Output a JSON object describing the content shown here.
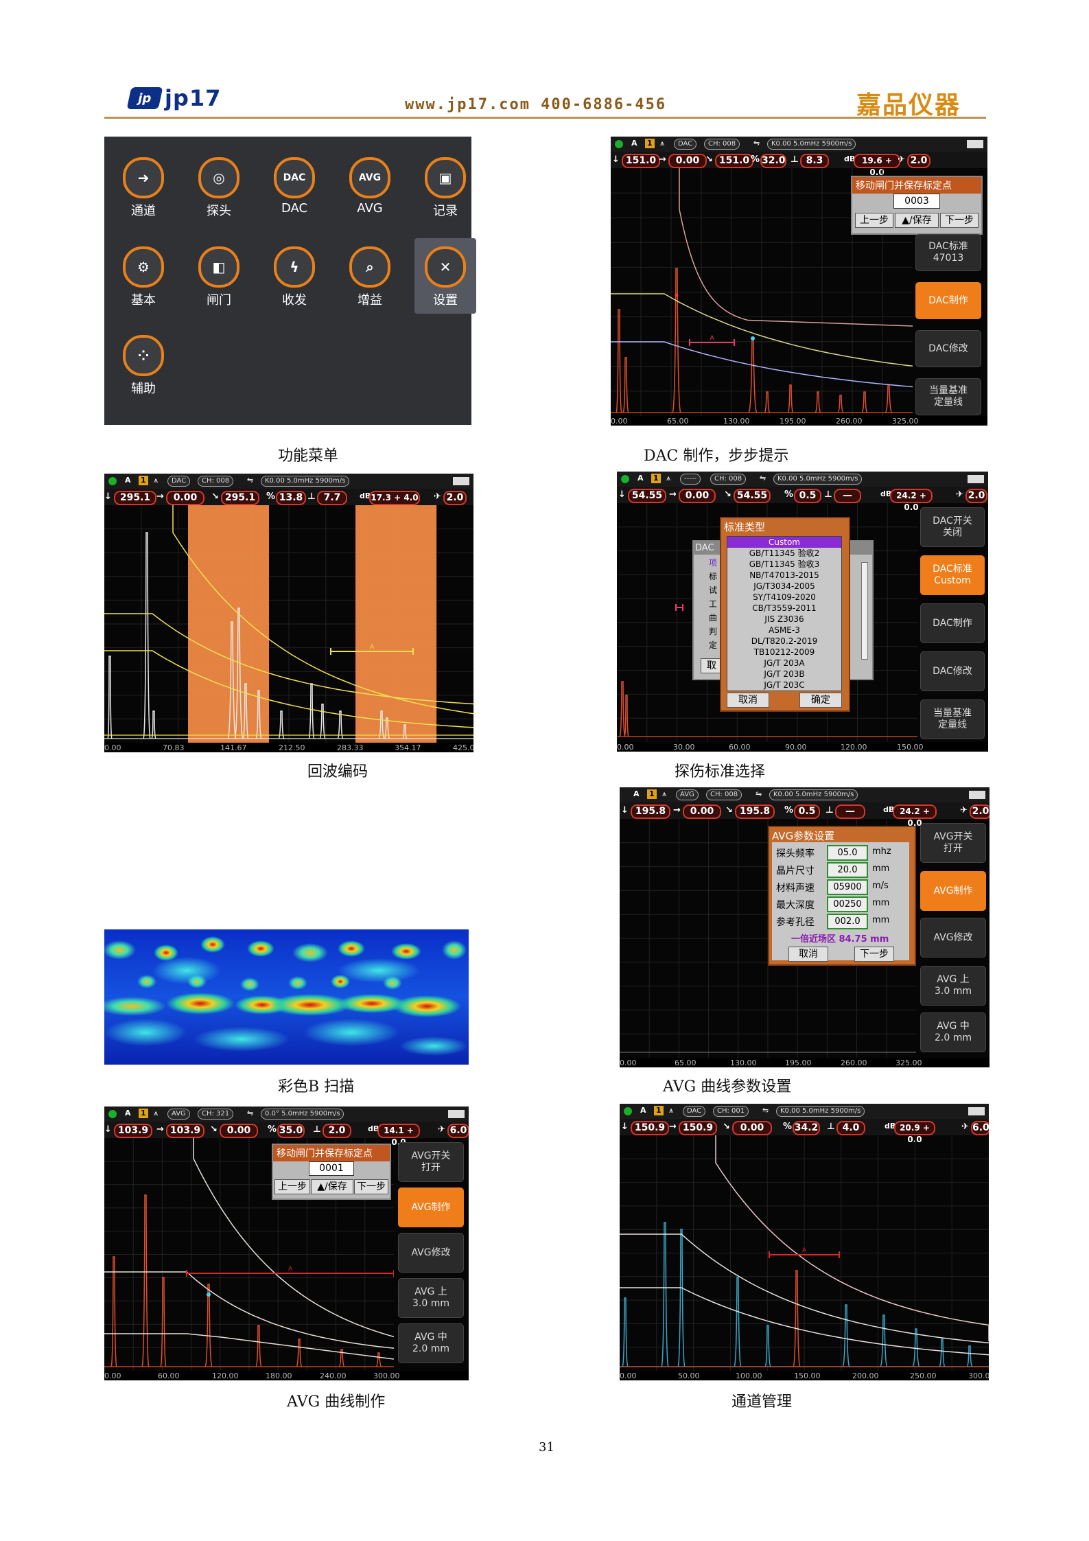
{
  "header": {
    "logo_mark": "jp",
    "logo_text": "jp17",
    "url": "www.jp17.com  400-6886-456",
    "brand": "嘉品仪器"
  },
  "page_number": "31",
  "captions": {
    "menu": "功能菜单",
    "dac_make": "DAC 制作，步步提示",
    "echo": "回波编码",
    "standard": "探伤标准选择",
    "bscan": "彩色B 扫描",
    "avg_param": "AVG 曲线参数设置",
    "avg_make": "AVG 曲线制作",
    "channel": "通道管理"
  },
  "menu": {
    "items": [
      {
        "label": "通道",
        "icon": "arrow-right-icon",
        "glyph": "➜"
      },
      {
        "label": "探头",
        "icon": "probe-icon",
        "glyph": "◎"
      },
      {
        "label": "DAC",
        "icon": "dac-icon",
        "glyph": "DAC"
      },
      {
        "label": "AVG",
        "icon": "avg-icon",
        "glyph": "AVG"
      },
      {
        "label": "记录",
        "icon": "save-icon",
        "glyph": "▣"
      },
      {
        "label": "基本",
        "icon": "gear-icon",
        "glyph": "⚙"
      },
      {
        "label": "闸门",
        "icon": "gate-icon",
        "glyph": "◧"
      },
      {
        "label": "收发",
        "icon": "pulse-icon",
        "glyph": "ϟ"
      },
      {
        "label": "增益",
        "icon": "search-icon",
        "glyph": "⌕"
      },
      {
        "label": "设置",
        "icon": "tools-icon",
        "glyph": "✕"
      },
      {
        "label": "辅助",
        "icon": "dots-icon",
        "glyph": "⁘"
      }
    ]
  },
  "dac": {
    "top": {
      "mode": "A",
      "num": "1",
      "type": "DAC",
      "ch": "CH: 008",
      "probe": "K0.00  5.0mHz  5900m/s"
    },
    "vals": [
      "151.0",
      "0.00",
      "151.0",
      "32.0",
      "8.3",
      "19.6 + 0.0",
      "2.0"
    ],
    "dialog": {
      "title": "移动闸门并保存标定点",
      "value": "0003",
      "prev": "上一步",
      "save": "▲/保存",
      "next": "下一步"
    },
    "buttons": [
      "DAC标准\n47013",
      "DAC制作",
      "DAC修改",
      "当量基准\n定量线"
    ],
    "axis": [
      "0.00",
      "65.00",
      "130.00",
      "195.00",
      "260.00",
      "325.00"
    ],
    "gate_label": "A"
  },
  "echo": {
    "top": {
      "mode": "A",
      "num": "1",
      "type": "DAC",
      "ch": "CH: 008",
      "probe": "K0.00  5.0mHz  5900m/s"
    },
    "vals": [
      "295.1",
      "0.00",
      "295.1",
      "13.8",
      "7.7",
      "17.3 + 4.0",
      "2.0"
    ],
    "axis": [
      "0.00",
      "70.83",
      "141.67",
      "212.50",
      "283.33",
      "354.17",
      "425.00"
    ],
    "gate_label": "A"
  },
  "standard": {
    "top": {
      "mode": "A",
      "num": "1",
      "type": "-----",
      "ch": "CH: 008",
      "probe": "K0.00  5.0mHz  5900m/s"
    },
    "vals": [
      "54.55",
      "0.00",
      "54.55",
      "0.5",
      "—",
      "24.2 + 0.0",
      "2.0"
    ],
    "dialog_title": "标准类型",
    "options": [
      "Custom",
      "GB/T11345 验收2",
      "GB/T11345 验收3",
      "NB/T47013-2015",
      "JG/T3034-2005",
      "SY/T4109-2020",
      "CB/T3559-2011",
      "JIS Z3036",
      "ASME-3",
      "DL/T820.2-2019",
      "TB10212-2009",
      "JG/T 203A",
      "JG/T 203B",
      "JG/T 203C"
    ],
    "cancel": "取消",
    "ok": "确定",
    "back_dialog": {
      "title": "DAC",
      "items": [
        "项",
        "标",
        "试",
        "工",
        "曲",
        "判",
        "定"
      ],
      "cancel": "取"
    },
    "buttons": [
      "DAC开关\n关闭",
      "DAC标准\nCustom",
      "DAC制作",
      "DAC修改",
      "当量基准\n定量线"
    ],
    "axis": [
      "0.00",
      "30.00",
      "60.00",
      "90.00",
      "120.00",
      "150.00"
    ]
  },
  "avg_param": {
    "top": {
      "mode": "A",
      "num": "1",
      "type": "AVG",
      "ch": "CH: 008",
      "probe": "K0.00  5.0mHz  5900m/s"
    },
    "vals": [
      "195.8",
      "0.00",
      "195.8",
      "0.5",
      "—",
      "24.2 + 0.0",
      "2.0"
    ],
    "dialog_title": "AVG参数设置",
    "fields": [
      {
        "label": "探头频率",
        "value": "05.0",
        "unit": "mhz"
      },
      {
        "label": "晶片尺寸",
        "value": "20.0",
        "unit": "mm"
      },
      {
        "label": "材料声速",
        "value": "05900",
        "unit": "m/s"
      },
      {
        "label": "最大深度",
        "value": "00250",
        "unit": "mm"
      },
      {
        "label": "参考孔径",
        "value": "002.0",
        "unit": "mm"
      }
    ],
    "near_field": "一倍近场区 84.75 mm",
    "cancel": "取消",
    "next": "下一步",
    "buttons": [
      "AVG开关\n打开",
      "AVG制作",
      "AVG修改",
      "AVG 上\n3.0 mm",
      "AVG 中\n2.0 mm"
    ],
    "axis": [
      "0.00",
      "65.00",
      "130.00",
      "195.00",
      "260.00",
      "325.00"
    ]
  },
  "avg_make": {
    "top": {
      "mode": "A",
      "num": "1",
      "type": "AVG",
      "ch": "CH: 321",
      "probe": "0.0°  5.0mHz  5900m/s"
    },
    "vals": [
      "103.9",
      "103.9",
      "0.00",
      "35.0",
      "2.0",
      "14.1 + 0.0",
      "6.0"
    ],
    "dialog": {
      "title": "移动闸门并保存标定点",
      "value": "0001",
      "prev": "上一步",
      "save": "▲/保存",
      "next": "下一步"
    },
    "buttons": [
      "AVG开关\n打开",
      "AVG制作",
      "AVG修改",
      "AVG 上\n3.0 mm",
      "AVG 中\n2.0 mm"
    ],
    "axis": [
      "0.00",
      "60.00",
      "120.00",
      "180.00",
      "240.00",
      "300.00"
    ],
    "gate_label": "A"
  },
  "channel": {
    "top": {
      "mode": "A",
      "num": "1",
      "type": "DAC",
      "ch": "CH: 001",
      "probe": "K0.00  5.0mHz  5900m/s"
    },
    "vals": [
      "150.9",
      "150.9",
      "0.00",
      "34.2",
      "4.0",
      "20.9 + 0.0",
      "6.0"
    ],
    "axis": [
      "0.00",
      "50.00",
      "100.00",
      "150.00",
      "200.00",
      "250.00",
      "300.00"
    ],
    "gate_label": "A"
  },
  "colors": {
    "accent": "#ef7d1a",
    "value_border": "#d0392b",
    "menu_ring": "#e8811c",
    "brand": "#d98a12",
    "logo": "#0d2f86"
  }
}
